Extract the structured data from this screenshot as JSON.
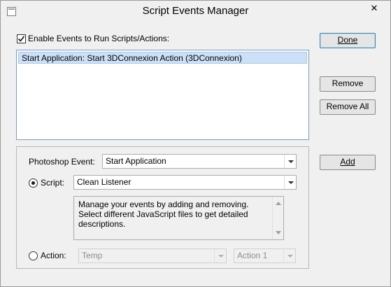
{
  "window": {
    "title": "Script Events Manager",
    "close_glyph": "✕"
  },
  "enable": {
    "label": "Enable Events to Run Scripts/Actions:",
    "checked": true
  },
  "events_list": {
    "items": [
      "Start Application: Start 3DConnexion Action (3DConnexion)"
    ]
  },
  "buttons": {
    "done": "Done",
    "remove": "Remove",
    "remove_all": "Remove All",
    "add": "Add"
  },
  "photoshop_event": {
    "label": "Photoshop Event:",
    "value": "Start Application"
  },
  "script": {
    "label": "Script:",
    "value": "Clean Listener",
    "selected": true
  },
  "description": "Manage your events by adding and removing. Select different JavaScript files to get detailed descriptions.",
  "action": {
    "label": "Action:",
    "set_value": "Temp",
    "action_value": "Action 1",
    "selected": false
  }
}
